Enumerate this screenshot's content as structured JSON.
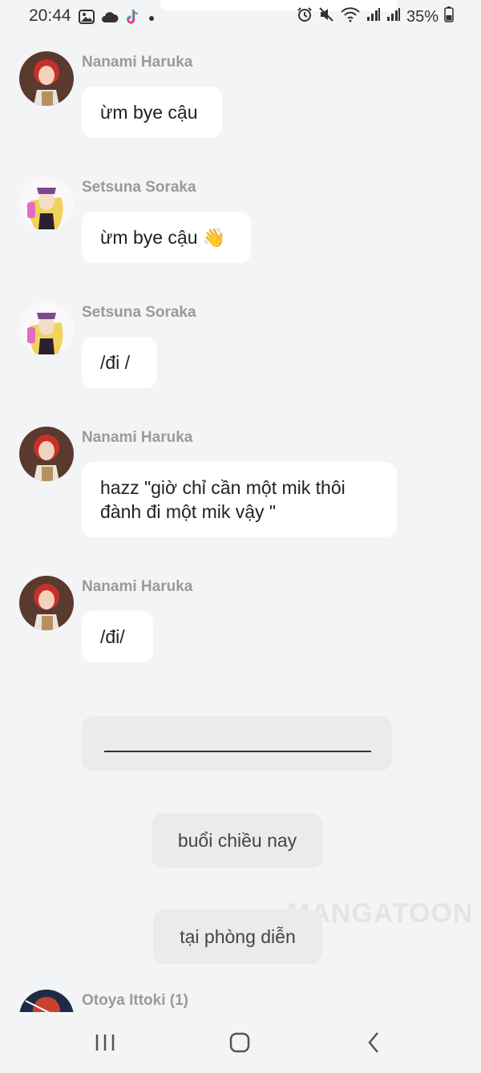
{
  "status_bar": {
    "time": "20:44",
    "battery": "35%",
    "left_icons": [
      "image-icon",
      "cloud-icon",
      "tiktok-icon",
      "dot-icon"
    ],
    "right_icons": [
      "alarm-icon",
      "mute-icon",
      "wifi-icon",
      "signal-icon",
      "signal-icon",
      "battery-icon"
    ]
  },
  "messages": [
    {
      "sender": "Nanami Haruka",
      "text": "ừm bye cậu"
    },
    {
      "sender": "Setsuna Soraka",
      "text": "ừm bye cậu 👋"
    },
    {
      "sender": "Setsuna Soraka",
      "text": "/đi /"
    },
    {
      "sender": "Nanami Haruka",
      "text": "hazz \"giờ chỉ cần một mik thôi đành đi một mik vậy \""
    },
    {
      "sender": "Nanami Haruka",
      "text": "/đi/"
    },
    {
      "sender": "Otoya Ittoki (1)",
      "text": ""
    }
  ],
  "narration": [
    {
      "text": "buổi chiều nay"
    },
    {
      "text": "tại phòng diễn"
    }
  ],
  "watermark": "MANGATOON",
  "nav": [
    "recents-button",
    "home-button",
    "back-button"
  ]
}
